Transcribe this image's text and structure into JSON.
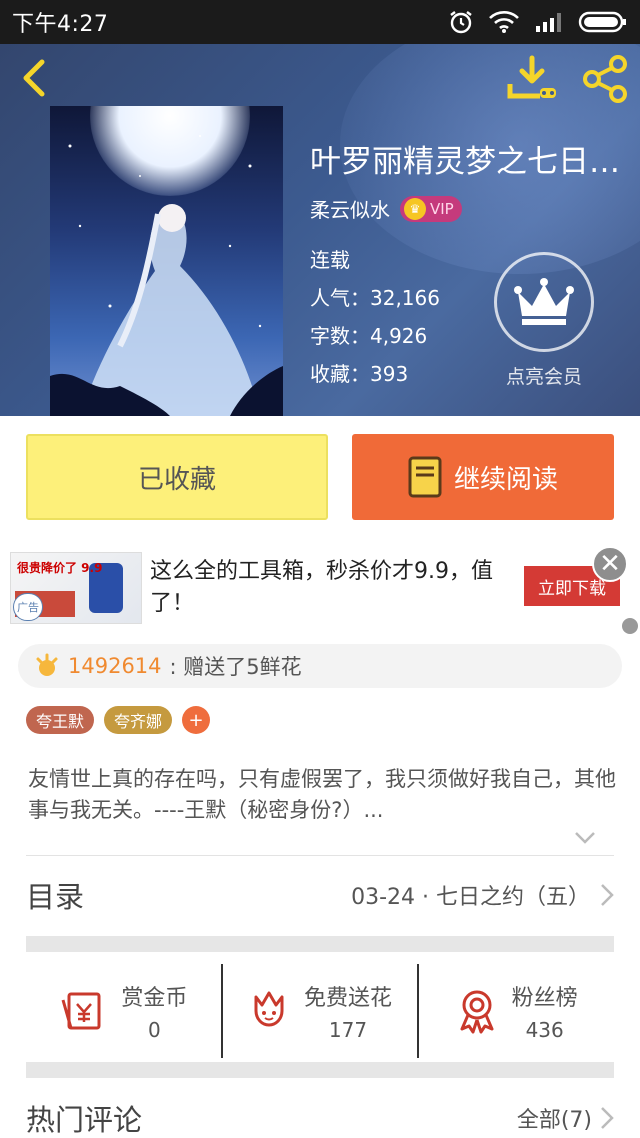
{
  "status_bar": {
    "time": "下午4:27"
  },
  "book": {
    "title": "叶罗丽精灵梦之七日…",
    "author": "柔云似水",
    "vip": "VIP",
    "status": "连载",
    "popularity": "人气：32,166",
    "word_count": "字数：4,926",
    "favorites": "收藏：393",
    "member_label": "点亮会员"
  },
  "actions": {
    "collected_label": "已收藏",
    "continue_label": "继续阅读"
  },
  "ad": {
    "image_price": "很贵降价了 9.9",
    "image_tag": "广告",
    "text": "这么全的工具箱，秒杀价才9.9，值了！",
    "cta": "立即下载",
    "close": "✕"
  },
  "gift": {
    "user_id": "1492614",
    "message": ": 赠送了5鲜花"
  },
  "tags": [
    "夸王默",
    "夸齐娜"
  ],
  "tag_add": "+",
  "intro": "友情世上真的存在吗，只有虚假罢了，我只须做好我自己，其他事与我无关。----王默（秘密身份?）...",
  "toc": {
    "label": "目录",
    "latest_chapter": "03-24 · 七日之约（五）"
  },
  "stats": {
    "reward_label": "赏金币",
    "reward_value": "0",
    "flower_label": "免费送花",
    "flower_value": "177",
    "fans_label": "粉丝榜",
    "fans_value": "436"
  },
  "hot_comments": {
    "label": "热门评论",
    "all": "全部(7)"
  },
  "colors": {
    "accent_orange": "#f06a38",
    "collected_yellow": "#fdf07a",
    "icon_red": "#c9392c"
  }
}
